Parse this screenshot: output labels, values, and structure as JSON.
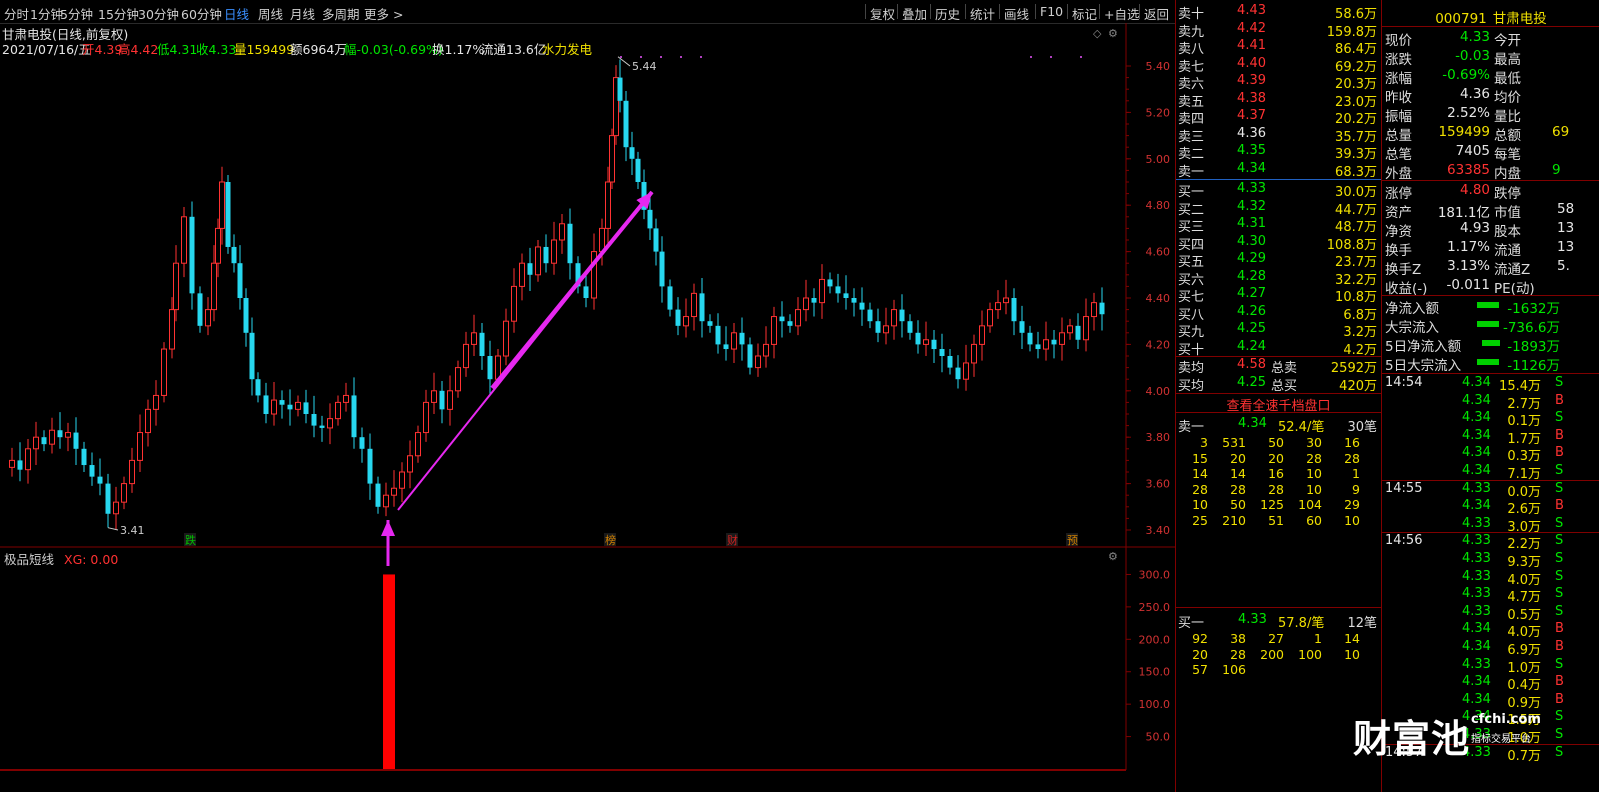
{
  "toolbar": {
    "left": [
      "分时",
      "1分钟",
      "5分钟",
      "15分钟",
      "30分钟",
      "60分钟",
      "日线",
      "周线",
      "月线",
      "多周期",
      "更多 >"
    ],
    "selected": "日线",
    "right": [
      "复权",
      "叠加",
      "历史",
      "统计",
      "画线",
      "F10",
      "标记",
      "+自选",
      "返回"
    ]
  },
  "info": {
    "title": "甘肃电投(日线,前复权)",
    "date": "2021/07/16/五",
    "open": "开4.39",
    "high": "高4.42",
    "low": "低4.31",
    "close": "收4.33",
    "volume": "量159499",
    "amount": "额6964万",
    "change": "幅-0.03(-0.69%)",
    "turnover": "换1.17%",
    "float": "流通13.6亿",
    "sector": "水力发电"
  },
  "chart_data": [
    {
      "type": "candlestick",
      "price_axis": [
        "5.40",
        "5.20",
        "5.00",
        "4.80",
        "4.60",
        "4.40",
        "4.20",
        "4.00",
        "3.80",
        "3.60",
        "3.40"
      ],
      "high_marker": "5.44",
      "low_marker": "3.41",
      "event_markers": [
        "跌",
        "榜",
        "财",
        "预"
      ],
      "ylim": [
        3.36,
        5.48
      ]
    },
    {
      "type": "bar",
      "title": "极品短线",
      "indicator": "XG: 0.00",
      "axis": [
        "300.0",
        "250.0",
        "200.0",
        "150.0",
        "100.0",
        "50.0"
      ],
      "ylim": [
        0,
        330
      ],
      "signal_value": 300
    }
  ],
  "orderbook": {
    "sells": [
      {
        "label": "卖十",
        "price": "4.43",
        "vol": "58.6万"
      },
      {
        "label": "卖九",
        "price": "4.42",
        "vol": "159.8万"
      },
      {
        "label": "卖八",
        "price": "4.41",
        "vol": "86.4万"
      },
      {
        "label": "卖七",
        "price": "4.40",
        "vol": "69.2万"
      },
      {
        "label": "卖六",
        "price": "4.39",
        "vol": "20.3万"
      },
      {
        "label": "卖五",
        "price": "4.38",
        "vol": "23.0万"
      },
      {
        "label": "卖四",
        "price": "4.37",
        "vol": "20.2万"
      },
      {
        "label": "卖三",
        "price": "4.36",
        "vol": "35.7万"
      },
      {
        "label": "卖二",
        "price": "4.35",
        "vol": "39.3万"
      },
      {
        "label": "卖一",
        "price": "4.34",
        "vol": "68.3万"
      }
    ],
    "buys": [
      {
        "label": "买一",
        "price": "4.33",
        "vol": "30.0万"
      },
      {
        "label": "买二",
        "price": "4.32",
        "vol": "44.7万"
      },
      {
        "label": "买三",
        "price": "4.31",
        "vol": "48.7万"
      },
      {
        "label": "买四",
        "price": "4.30",
        "vol": "108.8万"
      },
      {
        "label": "买五",
        "price": "4.29",
        "vol": "23.7万"
      },
      {
        "label": "买六",
        "price": "4.28",
        "vol": "32.2万"
      },
      {
        "label": "买七",
        "price": "4.27",
        "vol": "10.8万"
      },
      {
        "label": "买八",
        "price": "4.26",
        "vol": "6.8万"
      },
      {
        "label": "买九",
        "price": "4.25",
        "vol": "3.2万"
      },
      {
        "label": "买十",
        "price": "4.24",
        "vol": "4.2万"
      }
    ],
    "sell_avg": {
      "label": "卖均",
      "price": "4.58",
      "tlabel": "总卖",
      "total": "2592万"
    },
    "buy_avg": {
      "label": "买均",
      "price": "4.25",
      "tlabel": "总买",
      "total": "420万"
    },
    "link": "查看全速千档盘口",
    "sell_queue": {
      "label": "卖一",
      "price": "4.34",
      "avg": "52.4/笔",
      "count": "30笔",
      "rows": [
        [
          "3",
          "531",
          "50",
          "30",
          "16"
        ],
        [
          "15",
          "20",
          "20",
          "28",
          "28"
        ],
        [
          "14",
          "14",
          "16",
          "10",
          "1"
        ],
        [
          "28",
          "28",
          "28",
          "10",
          "9"
        ],
        [
          "10",
          "50",
          "125",
          "104",
          "29"
        ],
        [
          "25",
          "210",
          "51",
          "60",
          "10"
        ]
      ]
    },
    "buy_queue": {
      "label": "买一",
      "price": "4.33",
      "avg": "57.8/笔",
      "count": "12笔",
      "rows": [
        [
          "92",
          "38",
          "27",
          "1",
          "14"
        ],
        [
          "20",
          "28",
          "200",
          "100",
          "10"
        ],
        [
          "57",
          "106",
          "",
          "",
          ""
        ]
      ]
    }
  },
  "quote": {
    "code": "000791",
    "name": "甘肃电投",
    "rows": [
      [
        "现价",
        "4.33",
        "今开"
      ],
      [
        "涨跌",
        "-0.03",
        "最高"
      ],
      [
        "涨幅",
        "-0.69%",
        "最低"
      ],
      [
        "昨收",
        "4.36",
        "均价"
      ],
      [
        "振幅",
        "2.52%",
        "量比"
      ],
      [
        "总量",
        "159499",
        "总额"
      ],
      [
        "总笔",
        "7405",
        "每笔"
      ],
      [
        "外盘",
        "63385",
        "内盘"
      ]
    ],
    "right_cut": [
      "",
      "",
      "",
      "",
      "",
      "69",
      "",
      "9"
    ],
    "rows2": [
      [
        "涨停",
        "4.80",
        "跌停",
        ""
      ],
      [
        "资产",
        "181.1亿",
        "市值",
        "58"
      ],
      [
        "净资",
        "4.93",
        "股本",
        "13"
      ],
      [
        "换手",
        "1.17%",
        "流通",
        "13"
      ],
      [
        "换手Z",
        "3.13%",
        "流通Z",
        "5."
      ],
      [
        "收益(-)",
        "-0.011",
        "PE(动)",
        ""
      ]
    ],
    "flows": [
      {
        "label": "净流入额",
        "value": "-1632万"
      },
      {
        "label": "大宗流入",
        "value": "-736.6万"
      },
      {
        "label": "5日净流入额",
        "value": "-1893万"
      },
      {
        "label": "5日大宗流入",
        "value": "-1126万"
      }
    ],
    "ticks": [
      [
        "14:54",
        "4.34",
        "15.4万",
        "S"
      ],
      [
        "",
        "4.34",
        "2.7万",
        "B"
      ],
      [
        "",
        "4.34",
        "0.1万",
        "S"
      ],
      [
        "",
        "4.34",
        "1.7万",
        "B"
      ],
      [
        "",
        "4.34",
        "0.3万",
        "B"
      ],
      [
        "",
        "4.34",
        "7.1万",
        "S"
      ],
      [
        "14:55",
        "4.33",
        "0.0万",
        "S"
      ],
      [
        "",
        "4.34",
        "2.6万",
        "B"
      ],
      [
        "",
        "4.33",
        "3.0万",
        "S"
      ],
      [
        "14:56",
        "4.33",
        "2.2万",
        "S"
      ],
      [
        "",
        "4.33",
        "9.3万",
        "S"
      ],
      [
        "",
        "4.33",
        "4.0万",
        "S"
      ],
      [
        "",
        "4.33",
        "4.7万",
        "S"
      ],
      [
        "",
        "4.33",
        "0.5万",
        "S"
      ],
      [
        "",
        "4.34",
        "4.0万",
        "B"
      ],
      [
        "",
        "4.34",
        "6.9万",
        "B"
      ],
      [
        "",
        "4.33",
        "1.0万",
        "S"
      ],
      [
        "",
        "4.34",
        "0.4万",
        "B"
      ],
      [
        "",
        "4.34",
        "0.9万",
        "B"
      ],
      [
        "",
        "4.34",
        "1.5万",
        "S"
      ],
      [
        "",
        "4.33",
        "1.0万",
        "S"
      ],
      [
        "14:57",
        "4.33",
        "0.7万",
        "S"
      ]
    ]
  },
  "watermark": {
    "brand": "财富池",
    "site": "cfchi.com",
    "tagline": "指标交易平台"
  },
  "colors": {
    "up": "#ff3232",
    "down": "#27d7ef",
    "arrow": "#e628f0",
    "bg": "#000000",
    "border": "#800000"
  }
}
